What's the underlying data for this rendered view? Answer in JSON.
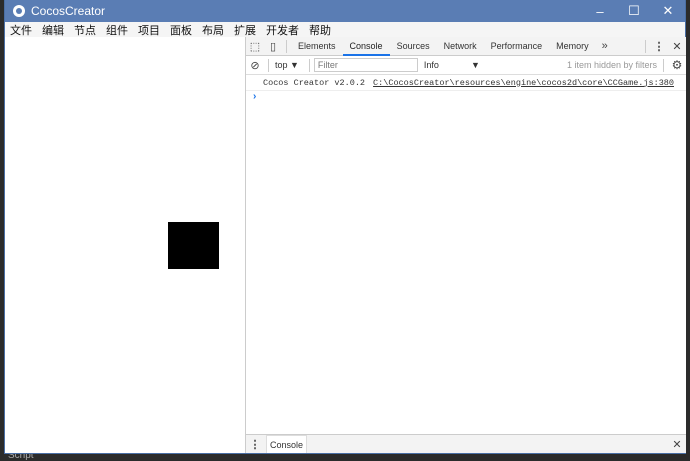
{
  "window": {
    "title": "CocosCreator",
    "minimize": "–",
    "maximize": "☐",
    "close": "✕"
  },
  "menu": [
    "文件",
    "编辑",
    "节点",
    "组件",
    "项目",
    "面板",
    "布局",
    "扩展",
    "开发者",
    "帮助"
  ],
  "devtools": {
    "tabs": [
      "Elements",
      "Console",
      "Sources",
      "Network",
      "Performance",
      "Memory"
    ],
    "active_tab": "Console",
    "more": "»",
    "kebab": "⋮",
    "close": "✕",
    "context": "top ▼",
    "filter_placeholder": "Filter",
    "level": "Info",
    "level_arrow": "▼",
    "hidden_note": "1 item hidden by filters",
    "log": {
      "text": "Cocos Creator v2.0.2",
      "source": "C:\\CocosCreator\\resources\\engine\\cocos2d\\core\\CCGame.js:380"
    },
    "prompt": "›",
    "drawer_tab": "Console"
  },
  "background_text": "Script"
}
